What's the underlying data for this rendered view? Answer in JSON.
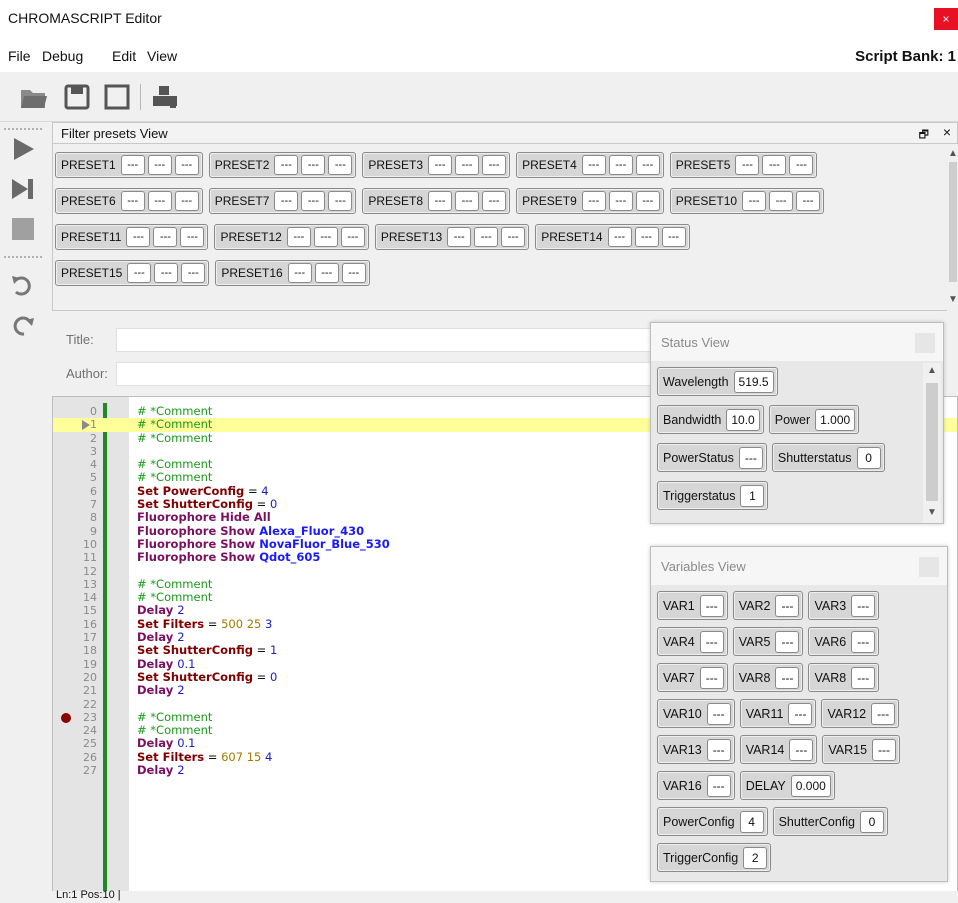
{
  "window": {
    "title": "CHROMASCRIPT Editor",
    "close_glyph": "×"
  },
  "menu": {
    "file": "File",
    "debug": "Debug",
    "edit": "Edit",
    "view": "View",
    "script_bank": "Script Bank: 1"
  },
  "toolbar": {
    "icons": [
      "open-folder-icon",
      "save-icon",
      "new-document-icon",
      "printer-icon"
    ]
  },
  "sidebar": {
    "icons": [
      "play-icon",
      "step-icon",
      "stop-icon",
      "undo-icon",
      "redo-icon"
    ]
  },
  "filter_presets": {
    "title": "Filter presets View",
    "rows": [
      [
        {
          "label": "PRESET1",
          "values": [
            "---",
            "---",
            "---"
          ]
        },
        {
          "label": "PRESET2",
          "values": [
            "---",
            "---",
            "---"
          ]
        },
        {
          "label": "PRESET3",
          "values": [
            "---",
            "---",
            "---"
          ]
        },
        {
          "label": "PRESET4",
          "values": [
            "---",
            "---",
            "---"
          ]
        },
        {
          "label": "PRESET5",
          "values": [
            "---",
            "---",
            "---"
          ]
        }
      ],
      [
        {
          "label": "PRESET6",
          "values": [
            "---",
            "---",
            "---"
          ]
        },
        {
          "label": "PRESET7",
          "values": [
            "---",
            "---",
            "---"
          ]
        },
        {
          "label": "PRESET8",
          "values": [
            "---",
            "---",
            "---"
          ]
        },
        {
          "label": "PRESET9",
          "values": [
            "---",
            "---",
            "---"
          ]
        },
        {
          "label": "PRESET10",
          "values": [
            "---",
            "---",
            "---"
          ]
        }
      ],
      [
        {
          "label": "PRESET11",
          "values": [
            "---",
            "---",
            "---"
          ]
        },
        {
          "label": "PRESET12",
          "values": [
            "---",
            "---",
            "---"
          ]
        },
        {
          "label": "PRESET13",
          "values": [
            "---",
            "---",
            "---"
          ]
        },
        {
          "label": "PRESET14",
          "values": [
            "---",
            "---",
            "---"
          ]
        }
      ],
      [
        {
          "label": "PRESET15",
          "values": [
            "---",
            "---",
            "---"
          ]
        },
        {
          "label": "PRESET16",
          "values": [
            "---",
            "---",
            "---"
          ]
        }
      ]
    ]
  },
  "meta": {
    "title_label": "Title:",
    "author_label": "Author:"
  },
  "editor": {
    "lines": [
      {
        "n": "0",
        "tokens": [
          {
            "t": "# *Comment",
            "c": "c-comment"
          }
        ]
      },
      {
        "n": "1",
        "tokens": [
          {
            "t": "# *Comment",
            "c": "c-comment"
          }
        ],
        "highlight": true,
        "cursor": true
      },
      {
        "n": "2",
        "tokens": [
          {
            "t": "# *Comment",
            "c": "c-comment"
          }
        ]
      },
      {
        "n": "3",
        "tokens": []
      },
      {
        "n": "4",
        "tokens": [
          {
            "t": "# *Comment",
            "c": "c-comment"
          }
        ]
      },
      {
        "n": "5",
        "tokens": [
          {
            "t": "# *Comment",
            "c": "c-comment"
          }
        ]
      },
      {
        "n": "6",
        "tokens": [
          {
            "t": "Set PowerConfig",
            "c": "c-set"
          },
          {
            "t": " = ",
            "c": ""
          },
          {
            "t": "4",
            "c": "c-num"
          }
        ]
      },
      {
        "n": "7",
        "tokens": [
          {
            "t": "Set ShutterConfig",
            "c": "c-set"
          },
          {
            "t": " = ",
            "c": ""
          },
          {
            "t": "0",
            "c": "c-num"
          }
        ]
      },
      {
        "n": "8",
        "tokens": [
          {
            "t": "Fluorophore Hide All",
            "c": "c-fl"
          }
        ]
      },
      {
        "n": "9",
        "tokens": [
          {
            "t": "Fluorophore Show ",
            "c": "c-fl"
          },
          {
            "t": "Alexa_Fluor_430",
            "c": "c-blue"
          }
        ]
      },
      {
        "n": "10",
        "tokens": [
          {
            "t": "Fluorophore Show ",
            "c": "c-fl"
          },
          {
            "t": "NovaFluor_Blue_530",
            "c": "c-blue"
          }
        ]
      },
      {
        "n": "11",
        "tokens": [
          {
            "t": "Fluorophore Show ",
            "c": "c-fl"
          },
          {
            "t": "Qdot_605",
            "c": "c-blue"
          }
        ]
      },
      {
        "n": "12",
        "tokens": []
      },
      {
        "n": "13",
        "tokens": [
          {
            "t": "# *Comment",
            "c": "c-comment"
          }
        ]
      },
      {
        "n": "14",
        "tokens": [
          {
            "t": "# *Comment",
            "c": "c-comment"
          }
        ]
      },
      {
        "n": "15",
        "tokens": [
          {
            "t": "Delay ",
            "c": "c-kw"
          },
          {
            "t": "2",
            "c": "c-num"
          }
        ]
      },
      {
        "n": "16",
        "tokens": [
          {
            "t": "Set Filters",
            "c": "c-set"
          },
          {
            "t": " = ",
            "c": ""
          },
          {
            "t": "500 25",
            "c": "c-num2"
          },
          {
            "t": " 3",
            "c": "c-num"
          }
        ]
      },
      {
        "n": "17",
        "tokens": [
          {
            "t": "Delay ",
            "c": "c-kw"
          },
          {
            "t": "2",
            "c": "c-num"
          }
        ]
      },
      {
        "n": "18",
        "tokens": [
          {
            "t": "Set ShutterConfig",
            "c": "c-set"
          },
          {
            "t": " = ",
            "c": ""
          },
          {
            "t": "1",
            "c": "c-num"
          }
        ]
      },
      {
        "n": "19",
        "tokens": [
          {
            "t": "Delay ",
            "c": "c-kw"
          },
          {
            "t": "0.1",
            "c": "c-num"
          }
        ]
      },
      {
        "n": "20",
        "tokens": [
          {
            "t": "Set ShutterConfig",
            "c": "c-set"
          },
          {
            "t": " = ",
            "c": ""
          },
          {
            "t": "0",
            "c": "c-num"
          }
        ]
      },
      {
        "n": "21",
        "tokens": [
          {
            "t": "Delay ",
            "c": "c-kw"
          },
          {
            "t": "2",
            "c": "c-num"
          }
        ]
      },
      {
        "n": "22",
        "tokens": []
      },
      {
        "n": "23",
        "tokens": [
          {
            "t": "# *Comment",
            "c": "c-comment"
          }
        ],
        "breakpoint": true
      },
      {
        "n": "24",
        "tokens": [
          {
            "t": "# *Comment",
            "c": "c-comment"
          }
        ]
      },
      {
        "n": "25",
        "tokens": [
          {
            "t": "Delay ",
            "c": "c-kw"
          },
          {
            "t": "0.1",
            "c": "c-num"
          }
        ]
      },
      {
        "n": "26",
        "tokens": [
          {
            "t": "Set Filters",
            "c": "c-set"
          },
          {
            "t": " = ",
            "c": ""
          },
          {
            "t": "607 15",
            "c": "c-num2"
          },
          {
            "t": " 4",
            "c": "c-num"
          }
        ]
      },
      {
        "n": "27",
        "tokens": [
          {
            "t": "Delay ",
            "c": "c-kw"
          },
          {
            "t": "2",
            "c": "c-num"
          }
        ]
      }
    ]
  },
  "statusbar": {
    "text": "Ln:1  Pos:10  |"
  },
  "status_view": {
    "title": "Status View",
    "rows": [
      [
        {
          "label": "Wavelength",
          "values": [
            "519.5"
          ]
        }
      ],
      [
        {
          "label": "Bandwidth",
          "values": [
            "10.0"
          ]
        },
        {
          "label": "Power",
          "values": [
            "1.000"
          ]
        }
      ],
      [
        {
          "label": "PowerStatus",
          "values": [
            "---"
          ]
        },
        {
          "label": "Shutterstatus",
          "values": [
            "0"
          ]
        }
      ],
      [
        {
          "label": "Triggerstatus",
          "values": [
            "1"
          ]
        }
      ]
    ]
  },
  "variables_view": {
    "title": "Variables View",
    "rows": [
      [
        {
          "label": "VAR1",
          "values": [
            "---"
          ]
        },
        {
          "label": "VAR2",
          "values": [
            "---"
          ]
        },
        {
          "label": "VAR3",
          "values": [
            "---"
          ]
        }
      ],
      [
        {
          "label": "VAR4",
          "values": [
            "---"
          ]
        },
        {
          "label": "VAR5",
          "values": [
            "---"
          ]
        },
        {
          "label": "VAR6",
          "values": [
            "---"
          ]
        }
      ],
      [
        {
          "label": "VAR7",
          "values": [
            "---"
          ]
        },
        {
          "label": "VAR8",
          "values": [
            "---"
          ]
        },
        {
          "label": "VAR8",
          "values": [
            "---"
          ]
        }
      ],
      [
        {
          "label": "VAR10",
          "values": [
            "---"
          ]
        },
        {
          "label": "VAR11",
          "values": [
            "---"
          ]
        },
        {
          "label": "VAR12",
          "values": [
            "---"
          ]
        }
      ],
      [
        {
          "label": "VAR13",
          "values": [
            "---"
          ]
        },
        {
          "label": "VAR14",
          "values": [
            "---"
          ]
        },
        {
          "label": "VAR15",
          "values": [
            "---"
          ]
        }
      ],
      [
        {
          "label": "VAR16",
          "values": [
            "---"
          ]
        },
        {
          "label": "DELAY",
          "values": [
            "0.000"
          ]
        }
      ],
      [
        {
          "label": "PowerConfig",
          "values": [
            "4"
          ]
        },
        {
          "label": "ShutterConfig",
          "values": [
            "0"
          ]
        }
      ],
      [
        {
          "label": "TriggerConfig",
          "values": [
            "2"
          ]
        }
      ]
    ]
  },
  "colors": {
    "breakpoint": "#8b0000",
    "gutter_marker": "#1f8a1f",
    "highlight": "#ffff99",
    "close_button": "#e81123"
  }
}
